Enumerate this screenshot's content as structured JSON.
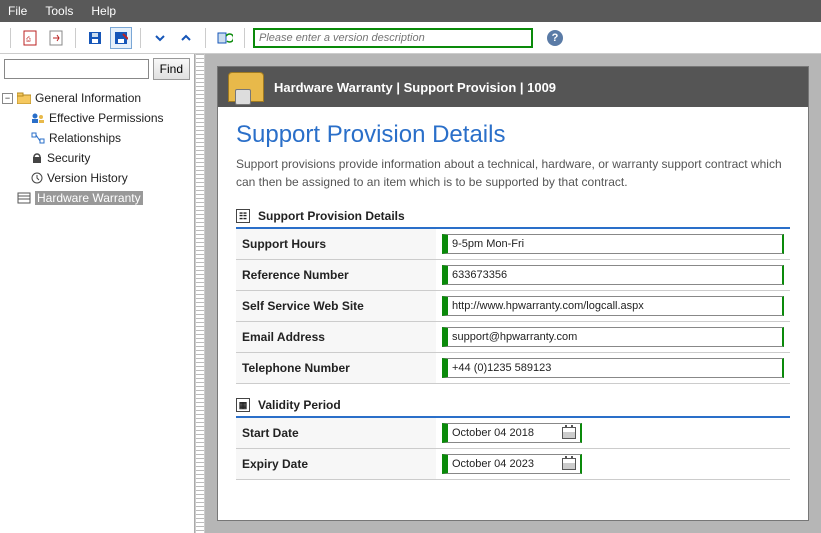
{
  "menu": {
    "file": "File",
    "tools": "Tools",
    "help": "Help"
  },
  "toolbar": {
    "version_placeholder": "Please enter a version description"
  },
  "find": {
    "button": "Find"
  },
  "tree": {
    "root": "General Information",
    "c1": "Effective Permissions",
    "c2": "Relationships",
    "c3": "Security",
    "c4": "Version History",
    "sel": "Hardware Warranty"
  },
  "header": {
    "title": "Hardware Warranty | Support Provision | 1009"
  },
  "page": {
    "title": "Support Provision Details",
    "desc": "Support provisions provide information about a technical, hardware, or warranty support contract which can then be assigned to an item which is to be supported by that contract."
  },
  "sect1": {
    "title": "Support Provision Details",
    "rows": {
      "support_hours_l": "Support Hours",
      "support_hours_v": "9-5pm Mon-Fri",
      "ref_l": "Reference Number",
      "ref_v": "633673356",
      "web_l": "Self Service Web Site",
      "web_v": "http://www.hpwarranty.com/logcall.aspx",
      "email_l": "Email Address",
      "email_v": "support@hpwarranty.com",
      "tel_l": "Telephone Number",
      "tel_v": "+44 (0)1235 589123"
    }
  },
  "sect2": {
    "title": "Validity Period",
    "rows": {
      "start_l": "Start Date",
      "start_v": "October   04 2018",
      "exp_l": "Expiry Date",
      "exp_v": "October   04 2023"
    }
  }
}
